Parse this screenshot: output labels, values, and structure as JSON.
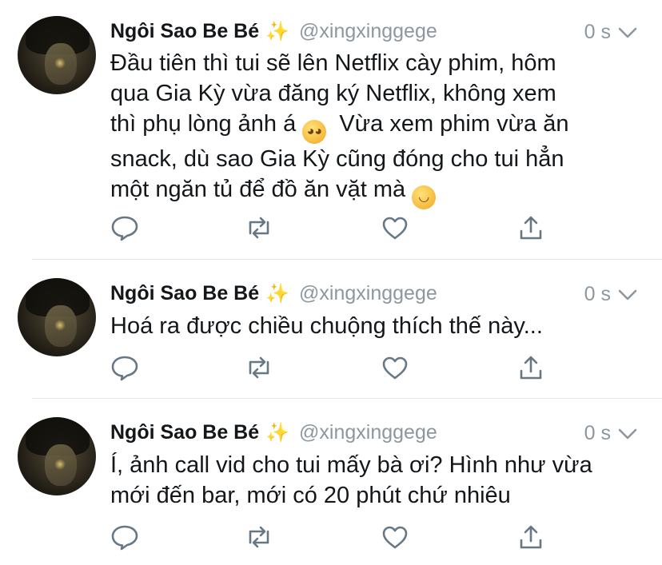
{
  "tweets": [
    {
      "name": "Ngôi Sao Be Bé",
      "sparkle": "✨",
      "handle": "@xingxinggege",
      "time": "0 s",
      "text_lines": [
        "Đầu tiên thì tui sẽ lên Netflix cày phim, hôm",
        "qua Gia Kỳ vừa đăng ký Netflix, không xem",
        "thì phụ lòng ảnh á",
        "Vừa xem phim vừa ăn",
        "snack, dù sao Gia Kỳ cũng đóng cho tui hẳn",
        "một ngăn tủ để đồ ăn vặt mà"
      ],
      "emoji_1": "pleading-face",
      "emoji_2": "smiling-face"
    },
    {
      "name": "Ngôi Sao Be Bé",
      "sparkle": "✨",
      "handle": "@xingxinggege",
      "time": "0 s",
      "text_lines": [
        "Hoá ra được chiều chuộng thích thế này..."
      ]
    },
    {
      "name": "Ngôi Sao Be Bé",
      "sparkle": "✨",
      "handle": "@xingxinggege",
      "time": "0 s",
      "text_lines": [
        "Í, ảnh call vid cho tui mấy bà ơi? Hình như vừa",
        "mới đến bar, mới có 20 phút chứ nhiêu"
      ]
    }
  ],
  "action_icons": [
    "reply-icon",
    "retweet-icon",
    "like-icon",
    "share-icon"
  ],
  "colors": {
    "text": "#14171a",
    "muted": "#8c97a0",
    "icon": "#667785",
    "divider": "#e1e8ed",
    "sparkle": "#f4c542"
  }
}
